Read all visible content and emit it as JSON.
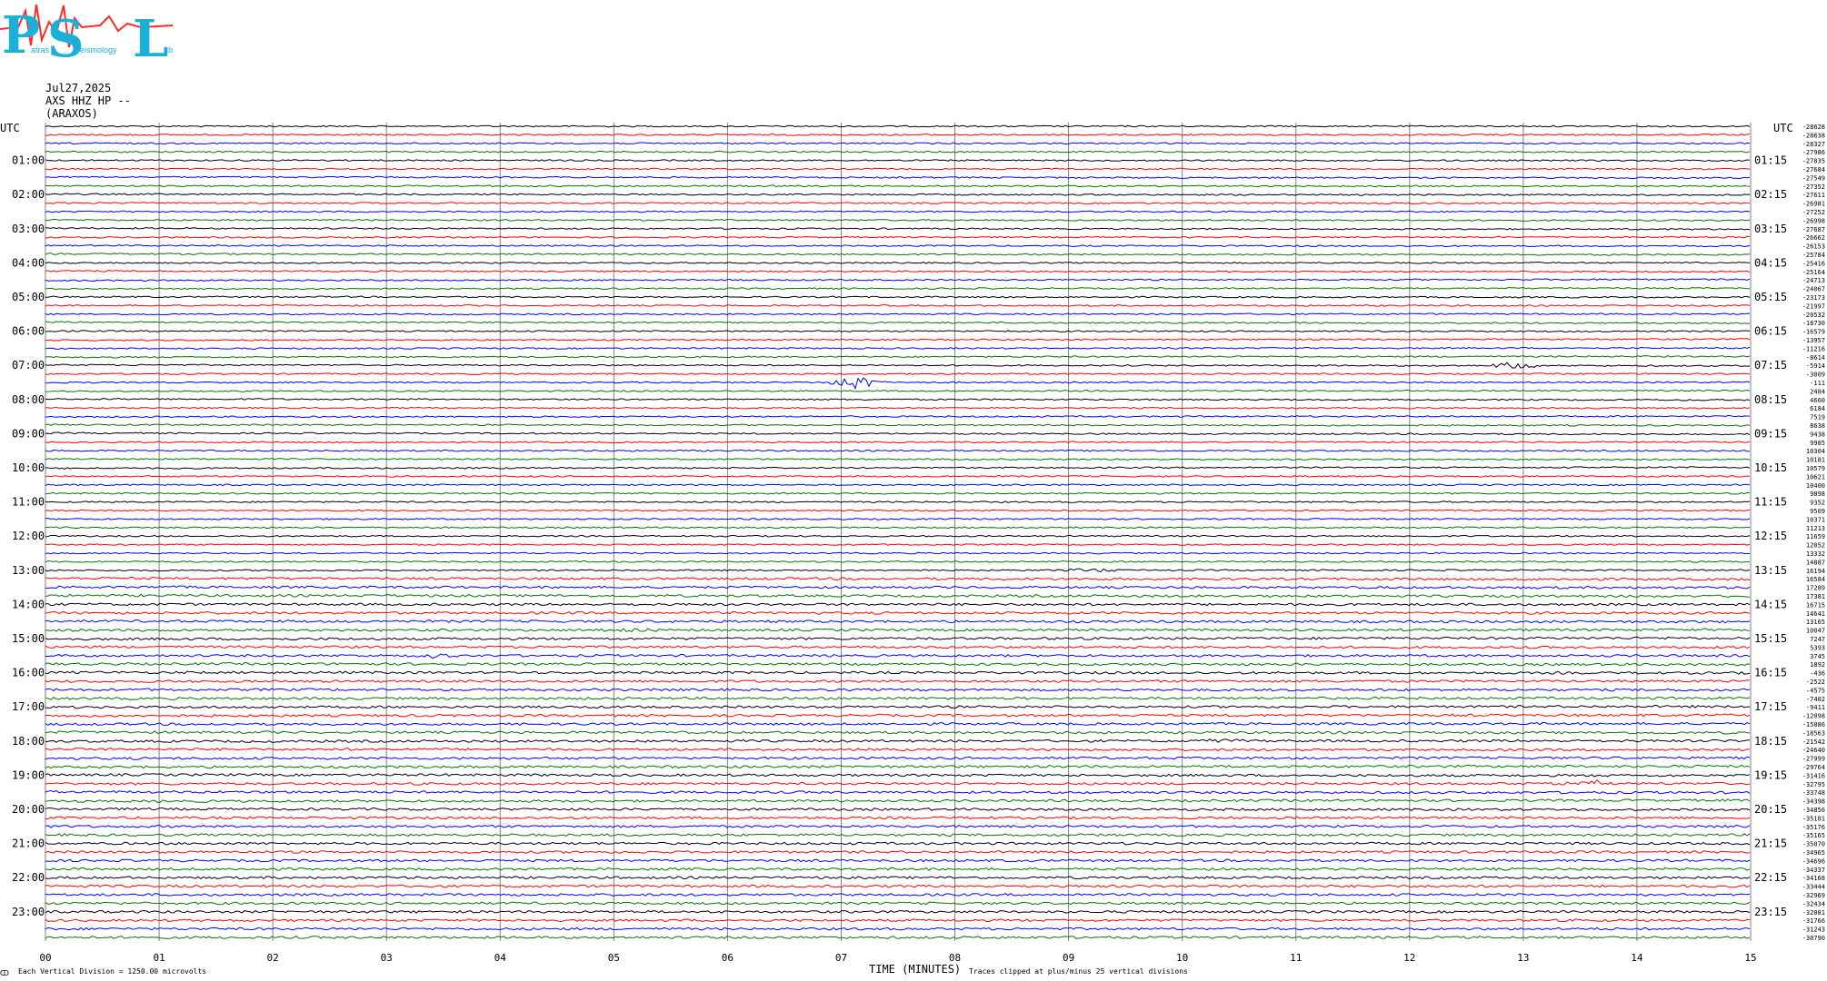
{
  "logo": {
    "letters": [
      "P",
      "S",
      "L"
    ],
    "words": [
      "atras",
      "eismology",
      "ab"
    ],
    "colors": {
      "letters": "#1ab0d8",
      "trace": "#ff2a2a"
    }
  },
  "header": {
    "date": "Jul27,2025",
    "station": "AXS HHZ HP --",
    "location": "(ARAXOS)"
  },
  "axis": {
    "left_title": "UTC",
    "right_title": "UTC",
    "x_label": "TIME (MINUTES)",
    "x_ticks": [
      "00",
      "01",
      "02",
      "03",
      "04",
      "05",
      "06",
      "07",
      "08",
      "09",
      "10",
      "11",
      "12",
      "13",
      "14",
      "15"
    ]
  },
  "footer": {
    "mark": "ↀ",
    "scale_note": "Each Vertical Division = 1250.00 microvolts",
    "clip_note": "Traces clipped at plus/minus 25 vertical divisions"
  },
  "colors": {
    "cycle": [
      "#000000",
      "#ff0000",
      "#0000ff",
      "#007700"
    ],
    "grid": "#808080"
  },
  "chart_data": {
    "type": "line",
    "title": "",
    "xlabel": "TIME (MINUTES)",
    "ylabel": "UTC",
    "xlim": [
      0,
      15
    ],
    "rows_per_hour": 4,
    "row_minutes": 15,
    "total_rows": 96,
    "left_hour_labels": [
      "01:00",
      "02:00",
      "03:00",
      "04:00",
      "05:00",
      "06:00",
      "07:00",
      "08:00",
      "09:00",
      "10:00",
      "11:00",
      "12:00",
      "13:00",
      "14:00",
      "15:00",
      "16:00",
      "17:00",
      "18:00",
      "19:00",
      "20:00",
      "21:00",
      "22:00",
      "23:00"
    ],
    "right_hour_labels": [
      "01:15",
      "02:15",
      "03:15",
      "04:15",
      "05:15",
      "06:15",
      "07:15",
      "08:15",
      "09:15",
      "10:15",
      "11:15",
      "12:15",
      "13:15",
      "14:15",
      "15:15",
      "16:15",
      "17:15",
      "18:15",
      "19:15",
      "20:15",
      "21:15",
      "22:15",
      "23:15"
    ],
    "row_offsets": [
      -28628,
      -28638,
      -28327,
      -27986,
      -27835,
      -27684,
      -27549,
      -27352,
      -27611,
      -26981,
      -27252,
      -26998,
      -27687,
      -26662,
      -26153,
      -25784,
      -25416,
      -25164,
      -24713,
      -24067,
      -23173,
      -21997,
      -20532,
      -18730,
      -16579,
      -13957,
      -11216,
      -8614,
      -5914,
      -3009,
      -111,
      2484,
      4660,
      6184,
      7519,
      8638,
      9438,
      9985,
      10304,
      10181,
      10579,
      10621,
      10400,
      9898,
      9352,
      9509,
      10371,
      11213,
      11659,
      12052,
      13332,
      14887,
      16194,
      16584,
      17289,
      17381,
      16715,
      14641,
      13165,
      10047,
      7247,
      5393,
      3745,
      1892,
      -436,
      -2522,
      -4575,
      -7402,
      -9411,
      -12098,
      -15086,
      -18563,
      -21542,
      -24640,
      -27999,
      -29764,
      -31416,
      -32795,
      -33748,
      -34398,
      -34856,
      -35101,
      -35176,
      -35165,
      -35070,
      -34965,
      -34696,
      -34337,
      -34168,
      -33444,
      -32969,
      -32434,
      -32081,
      -31766,
      -31243,
      -30790
    ],
    "events": [
      {
        "hour": 7,
        "row": 2,
        "minute": 7.15,
        "amplitude": 8
      },
      {
        "hour": 7,
        "row": 0,
        "minute": 12.9,
        "amplitude": 3
      },
      {
        "hour": 13,
        "row": 0,
        "minute": 9.2,
        "amplitude": 2
      },
      {
        "hour": 14,
        "row": 3,
        "minute": 5.1,
        "amplitude": 2
      },
      {
        "hour": 15,
        "row": 2,
        "minute": 3.4,
        "amplitude": 2
      },
      {
        "hour": 18,
        "row": 0,
        "minute": 10.4,
        "amplitude": 2
      },
      {
        "hour": 19,
        "row": 1,
        "minute": 13.6,
        "amplitude": 3
      }
    ]
  }
}
